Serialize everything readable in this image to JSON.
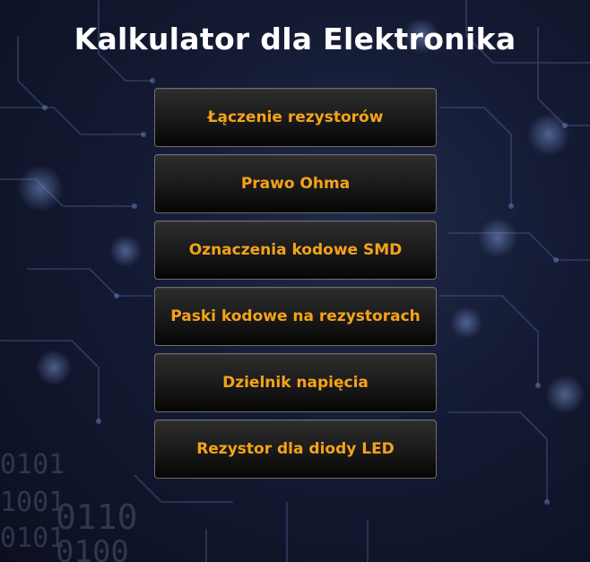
{
  "app": {
    "title": "Kalkulator dla Elektronika"
  },
  "menu": {
    "items": [
      {
        "label": "Łączenie rezystorów"
      },
      {
        "label": "Prawo Ohma"
      },
      {
        "label": "Oznaczenia kodowe SMD"
      },
      {
        "label": "Paski kodowe na rezystorach"
      },
      {
        "label": "Dzielnik napięcia"
      },
      {
        "label": "Rezystor dla diody LED"
      }
    ]
  },
  "background": {
    "binary_lines": [
      "0101",
      "1001",
      "0110",
      "0101",
      "0100"
    ]
  },
  "colors": {
    "accent": "#f5a319",
    "title": "#ffffff",
    "background": "#141a33"
  }
}
